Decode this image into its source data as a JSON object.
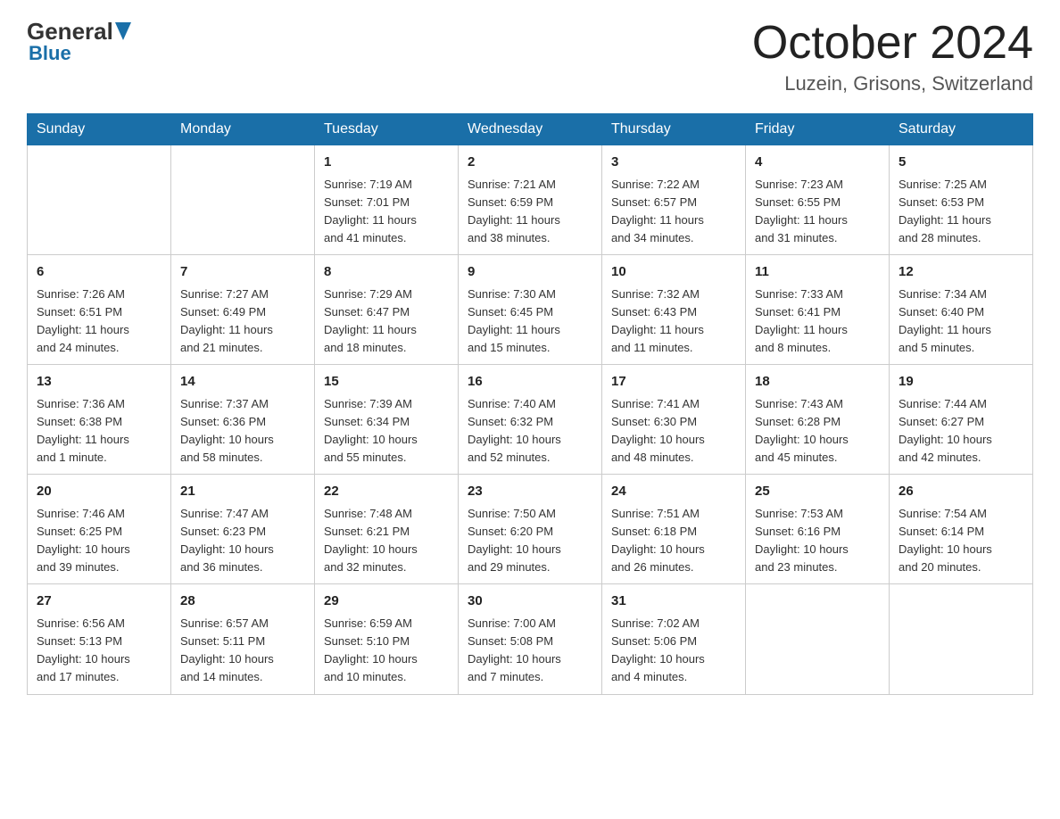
{
  "header": {
    "logo_general": "General",
    "logo_blue": "Blue",
    "month_title": "October 2024",
    "location": "Luzein, Grisons, Switzerland"
  },
  "days_of_week": [
    "Sunday",
    "Monday",
    "Tuesday",
    "Wednesday",
    "Thursday",
    "Friday",
    "Saturday"
  ],
  "weeks": [
    [
      {
        "day": "",
        "info": ""
      },
      {
        "day": "",
        "info": ""
      },
      {
        "day": "1",
        "info": "Sunrise: 7:19 AM\nSunset: 7:01 PM\nDaylight: 11 hours\nand 41 minutes."
      },
      {
        "day": "2",
        "info": "Sunrise: 7:21 AM\nSunset: 6:59 PM\nDaylight: 11 hours\nand 38 minutes."
      },
      {
        "day": "3",
        "info": "Sunrise: 7:22 AM\nSunset: 6:57 PM\nDaylight: 11 hours\nand 34 minutes."
      },
      {
        "day": "4",
        "info": "Sunrise: 7:23 AM\nSunset: 6:55 PM\nDaylight: 11 hours\nand 31 minutes."
      },
      {
        "day": "5",
        "info": "Sunrise: 7:25 AM\nSunset: 6:53 PM\nDaylight: 11 hours\nand 28 minutes."
      }
    ],
    [
      {
        "day": "6",
        "info": "Sunrise: 7:26 AM\nSunset: 6:51 PM\nDaylight: 11 hours\nand 24 minutes."
      },
      {
        "day": "7",
        "info": "Sunrise: 7:27 AM\nSunset: 6:49 PM\nDaylight: 11 hours\nand 21 minutes."
      },
      {
        "day": "8",
        "info": "Sunrise: 7:29 AM\nSunset: 6:47 PM\nDaylight: 11 hours\nand 18 minutes."
      },
      {
        "day": "9",
        "info": "Sunrise: 7:30 AM\nSunset: 6:45 PM\nDaylight: 11 hours\nand 15 minutes."
      },
      {
        "day": "10",
        "info": "Sunrise: 7:32 AM\nSunset: 6:43 PM\nDaylight: 11 hours\nand 11 minutes."
      },
      {
        "day": "11",
        "info": "Sunrise: 7:33 AM\nSunset: 6:41 PM\nDaylight: 11 hours\nand 8 minutes."
      },
      {
        "day": "12",
        "info": "Sunrise: 7:34 AM\nSunset: 6:40 PM\nDaylight: 11 hours\nand 5 minutes."
      }
    ],
    [
      {
        "day": "13",
        "info": "Sunrise: 7:36 AM\nSunset: 6:38 PM\nDaylight: 11 hours\nand 1 minute."
      },
      {
        "day": "14",
        "info": "Sunrise: 7:37 AM\nSunset: 6:36 PM\nDaylight: 10 hours\nand 58 minutes."
      },
      {
        "day": "15",
        "info": "Sunrise: 7:39 AM\nSunset: 6:34 PM\nDaylight: 10 hours\nand 55 minutes."
      },
      {
        "day": "16",
        "info": "Sunrise: 7:40 AM\nSunset: 6:32 PM\nDaylight: 10 hours\nand 52 minutes."
      },
      {
        "day": "17",
        "info": "Sunrise: 7:41 AM\nSunset: 6:30 PM\nDaylight: 10 hours\nand 48 minutes."
      },
      {
        "day": "18",
        "info": "Sunrise: 7:43 AM\nSunset: 6:28 PM\nDaylight: 10 hours\nand 45 minutes."
      },
      {
        "day": "19",
        "info": "Sunrise: 7:44 AM\nSunset: 6:27 PM\nDaylight: 10 hours\nand 42 minutes."
      }
    ],
    [
      {
        "day": "20",
        "info": "Sunrise: 7:46 AM\nSunset: 6:25 PM\nDaylight: 10 hours\nand 39 minutes."
      },
      {
        "day": "21",
        "info": "Sunrise: 7:47 AM\nSunset: 6:23 PM\nDaylight: 10 hours\nand 36 minutes."
      },
      {
        "day": "22",
        "info": "Sunrise: 7:48 AM\nSunset: 6:21 PM\nDaylight: 10 hours\nand 32 minutes."
      },
      {
        "day": "23",
        "info": "Sunrise: 7:50 AM\nSunset: 6:20 PM\nDaylight: 10 hours\nand 29 minutes."
      },
      {
        "day": "24",
        "info": "Sunrise: 7:51 AM\nSunset: 6:18 PM\nDaylight: 10 hours\nand 26 minutes."
      },
      {
        "day": "25",
        "info": "Sunrise: 7:53 AM\nSunset: 6:16 PM\nDaylight: 10 hours\nand 23 minutes."
      },
      {
        "day": "26",
        "info": "Sunrise: 7:54 AM\nSunset: 6:14 PM\nDaylight: 10 hours\nand 20 minutes."
      }
    ],
    [
      {
        "day": "27",
        "info": "Sunrise: 6:56 AM\nSunset: 5:13 PM\nDaylight: 10 hours\nand 17 minutes."
      },
      {
        "day": "28",
        "info": "Sunrise: 6:57 AM\nSunset: 5:11 PM\nDaylight: 10 hours\nand 14 minutes."
      },
      {
        "day": "29",
        "info": "Sunrise: 6:59 AM\nSunset: 5:10 PM\nDaylight: 10 hours\nand 10 minutes."
      },
      {
        "day": "30",
        "info": "Sunrise: 7:00 AM\nSunset: 5:08 PM\nDaylight: 10 hours\nand 7 minutes."
      },
      {
        "day": "31",
        "info": "Sunrise: 7:02 AM\nSunset: 5:06 PM\nDaylight: 10 hours\nand 4 minutes."
      },
      {
        "day": "",
        "info": ""
      },
      {
        "day": "",
        "info": ""
      }
    ]
  ]
}
